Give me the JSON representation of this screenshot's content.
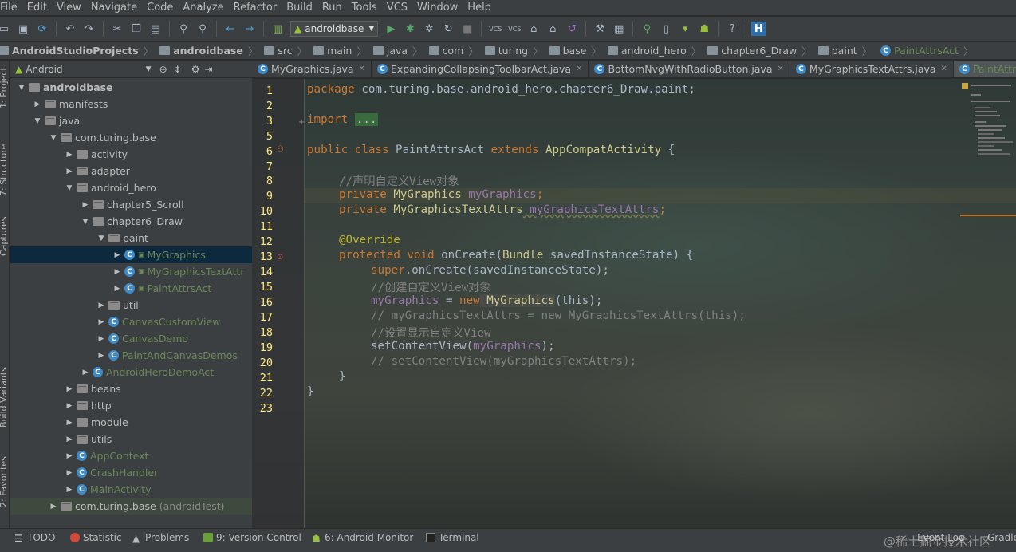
{
  "menubar": {
    "items": [
      "File",
      "Edit",
      "View",
      "Navigate",
      "Code",
      "Analyze",
      "Refactor",
      "Build",
      "Run",
      "Tools",
      "VCS",
      "Window",
      "Help"
    ]
  },
  "toolbar": {
    "run_config": "androidbase"
  },
  "navbar": {
    "crumbs": [
      "AndroidStudioProjects",
      "androidbase",
      "src",
      "main",
      "java",
      "com",
      "turing",
      "base",
      "android_hero",
      "chapter6_Draw",
      "paint",
      "PaintAttrsAct"
    ]
  },
  "leftstrip": {
    "project": "1: Project",
    "structure": "7: Structure",
    "captures": "Captures",
    "build_variants": "Build Variants",
    "favorites": "2: Favorites"
  },
  "project_panel": {
    "view": "Android"
  },
  "tree": [
    {
      "label": "androidbase",
      "indent": 0,
      "type": "folder",
      "open": true
    },
    {
      "label": "manifests",
      "indent": 1,
      "type": "folder",
      "open": false
    },
    {
      "label": "java",
      "indent": 1,
      "type": "folder",
      "open": true
    },
    {
      "label": "com.turing.base",
      "indent": 2,
      "type": "folder",
      "open": true
    },
    {
      "label": "activity",
      "indent": 3,
      "type": "folder",
      "open": false
    },
    {
      "label": "adapter",
      "indent": 3,
      "type": "folder",
      "open": false
    },
    {
      "label": "android_hero",
      "indent": 3,
      "type": "folder",
      "open": true
    },
    {
      "label": "chapter5_Scroll",
      "indent": 4,
      "type": "folder",
      "open": false
    },
    {
      "label": "chapter6_Draw",
      "indent": 4,
      "type": "folder",
      "open": true
    },
    {
      "label": "paint",
      "indent": 5,
      "type": "folder",
      "open": true
    },
    {
      "label": "MyGraphics",
      "indent": 6,
      "type": "class",
      "open": false,
      "selected": true
    },
    {
      "label": "MyGraphicsTextAttr",
      "indent": 6,
      "type": "class",
      "open": false
    },
    {
      "label": "PaintAttrsAct",
      "indent": 6,
      "type": "class",
      "open": false
    },
    {
      "label": "util",
      "indent": 5,
      "type": "folder",
      "open": false
    },
    {
      "label": "CanvasCustomView",
      "indent": 5,
      "type": "class",
      "open": false
    },
    {
      "label": "CanvasDemo",
      "indent": 5,
      "type": "class",
      "open": false
    },
    {
      "label": "PaintAndCanvasDemos",
      "indent": 5,
      "type": "class",
      "open": false
    },
    {
      "label": "AndroidHeroDemoAct",
      "indent": 4,
      "type": "class",
      "open": false
    },
    {
      "label": "beans",
      "indent": 3,
      "type": "folder",
      "open": false
    },
    {
      "label": "http",
      "indent": 3,
      "type": "folder",
      "open": false
    },
    {
      "label": "module",
      "indent": 3,
      "type": "folder",
      "open": false
    },
    {
      "label": "utils",
      "indent": 3,
      "type": "folder",
      "open": false
    },
    {
      "label": "AppContext",
      "indent": 3,
      "type": "class",
      "open": false
    },
    {
      "label": "CrashHandler",
      "indent": 3,
      "type": "class",
      "open": false
    },
    {
      "label": "MainActivity",
      "indent": 3,
      "type": "class",
      "open": false
    },
    {
      "label": "com.turing.base",
      "suffix": "(androidTest)",
      "indent": 2,
      "type": "folder",
      "open": false
    }
  ],
  "editor_tabs": [
    {
      "label": "MyGraphics.java",
      "active": false
    },
    {
      "label": "ExpandingCollapsingToolbarAct.java",
      "active": false
    },
    {
      "label": "BottomNvgWithRadioButton.java",
      "active": false
    },
    {
      "label": "MyGraphicsTextAttrs.java",
      "active": false
    },
    {
      "label": "PaintAttrsAct.java",
      "active": true
    }
  ],
  "code": {
    "line_numbers": [
      "1",
      "2",
      "3",
      "5",
      "6",
      "7",
      "8",
      "9",
      "10",
      "11",
      "12",
      "13",
      "14",
      "15",
      "16",
      "17",
      "18",
      "19",
      "20",
      "21",
      "22",
      "23"
    ],
    "l1_kw": "package",
    "l1_pkg": " com.turing.base.android_hero.chapter6_Draw.paint;",
    "l3_kw": "import",
    "l3_fold": "...",
    "l6_kw": "public class",
    "l6_name": " PaintAttrsAct ",
    "l6_ext": "extends",
    "l6_parent": " AppCompatActivity",
    "l6_brace": " {",
    "l8_comment": "//声明自定义View对象",
    "l9_kw": "private",
    "l9_type": " MyGraphics",
    "l9_field": " myGraphics",
    "l10_kw": "private",
    "l10_type": " MyGraphicsTextAttrs",
    "l10_field": " myGraphicsTextAttrs",
    "l12_ann": "@Override",
    "l13_kw": "protected void",
    "l13_name": " onCreate(",
    "l13_type": "Bundle",
    "l13_param": " savedInstanceState",
    ") {": "",
    "l13_end": ") {",
    "l14_kw": "super",
    "l14_rest": ".onCreate(savedInstanceState);",
    "l15_comment": "//创建自定义View对象",
    "l16_field": "myGraphics",
    "l16_eq": " = ",
    "l16_new": "new",
    "l16_type": " MyGraphics",
    "l16_rest": "(this);",
    "l17_comment": "// myGraphicsTextAttrs = new MyGraphicsTextAttrs(this);",
    "l18_comment": "//设置显示自定义View",
    "l19_call": "setContentView(",
    "l19_field": "myGraphics",
    "l19_end": ");",
    "l20_comment": "// setContentView(myGraphicsTextAttrs);",
    "l21": "}",
    "l22": "}",
    "semicolon": ";"
  },
  "statusbar": {
    "todo": "TODO",
    "statistic": "Statistic",
    "problems": "Problems",
    "version_control": "9: Version Control",
    "android_monitor": "6: Android Monitor",
    "terminal": "Terminal",
    "event_log": "Event Log",
    "gradle": "Gradle",
    "watermark": "@稀土掘金技术社区"
  }
}
